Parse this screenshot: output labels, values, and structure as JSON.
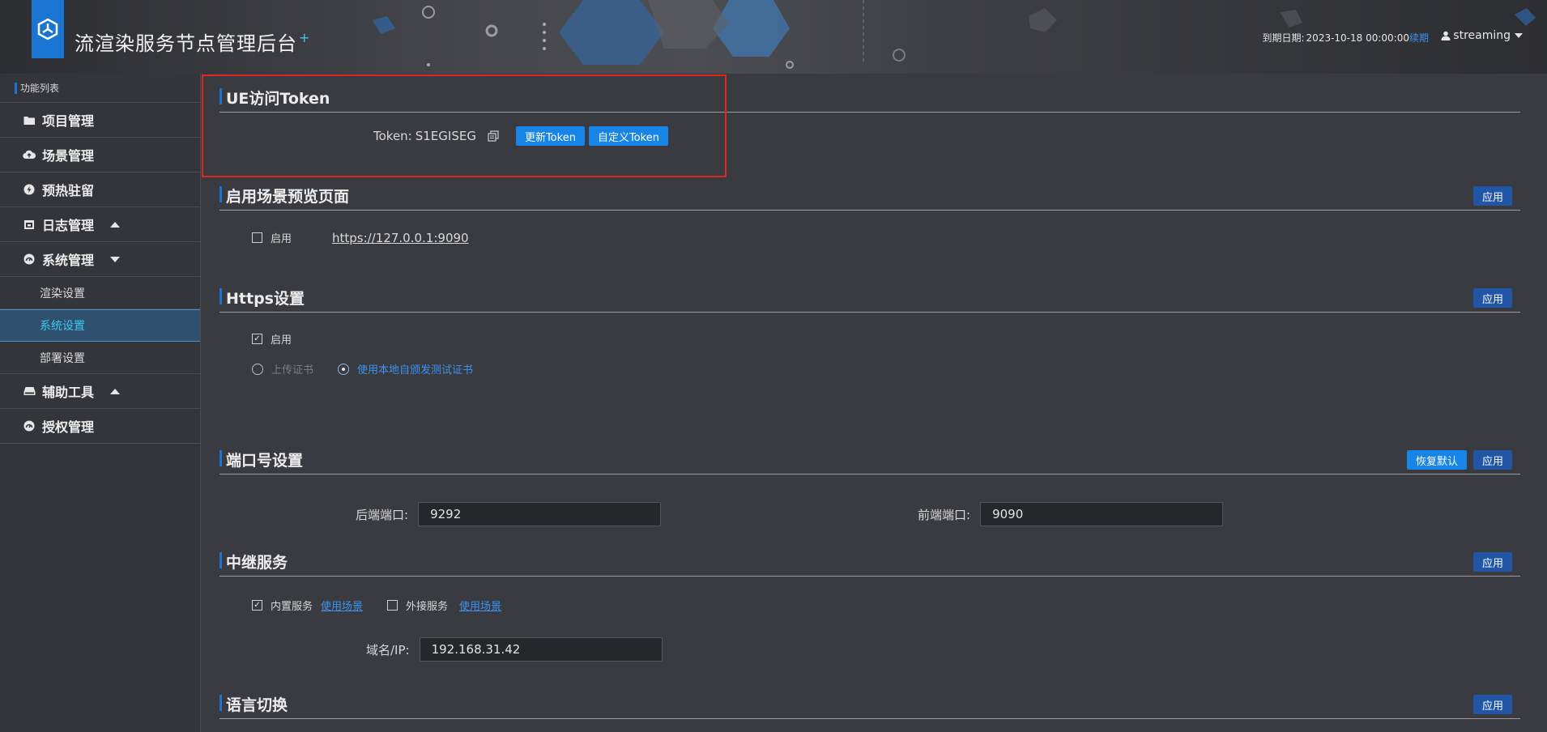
{
  "header": {
    "title": "流渲染服务节点管理后台",
    "title_mark": "+",
    "expire_label": "到期日期:",
    "expire_date": "2023-10-18 00:00:00",
    "renew": "续期",
    "user": "streaming"
  },
  "sidebar": {
    "heading": "功能列表",
    "items": [
      {
        "label": "项目管理",
        "icon": "folder-icon"
      },
      {
        "label": "场景管理",
        "icon": "cloud-upload-icon"
      },
      {
        "label": "预热驻留",
        "icon": "bolt-icon"
      },
      {
        "label": "日志管理",
        "icon": "calendar-icon"
      },
      {
        "label": "系统管理",
        "icon": "dashboard-icon"
      },
      {
        "label": "辅助工具",
        "icon": "drive-icon"
      },
      {
        "label": "授权管理",
        "icon": "dashboard-icon"
      }
    ],
    "sub_items": [
      "渲染设置",
      "系统设置",
      "部署设置"
    ],
    "active_sub": "系统设置"
  },
  "sections": {
    "token": {
      "title": "UE访问Token",
      "label": "Token:",
      "value": "S1EGISEG",
      "refresh_btn": "更新Token",
      "custom_btn": "自定义Token"
    },
    "preview": {
      "title": "启用场景预览页面",
      "apply": "应用",
      "enable_label": "启用",
      "url": "https://127.0.0.1:9090",
      "enabled": false
    },
    "https": {
      "title": "Https设置",
      "apply": "应用",
      "enable_label": "启用",
      "enabled": true,
      "upload_cert": "上传证书",
      "local_cert": "使用本地自颁发测试证书"
    },
    "ports": {
      "title": "端口号设置",
      "restore": "恢复默认",
      "apply": "应用",
      "backend_label": "后端端口:",
      "backend_value": "9292",
      "frontend_label": "前端端口:",
      "frontend_value": "9090"
    },
    "relay": {
      "title": "中继服务",
      "apply": "应用",
      "builtin_label": "内置服务",
      "builtin_checked": true,
      "builtin_link": "使用场景",
      "external_label": "外接服务",
      "external_checked": false,
      "external_link": "使用场景",
      "domain_label": "域名/IP:",
      "domain_value": "192.168.31.42"
    },
    "language": {
      "title": "语言切换",
      "apply": "应用"
    }
  },
  "colors": {
    "accent": "#1a74d2",
    "link": "#3a93f0",
    "highlight": "#e0261e"
  }
}
